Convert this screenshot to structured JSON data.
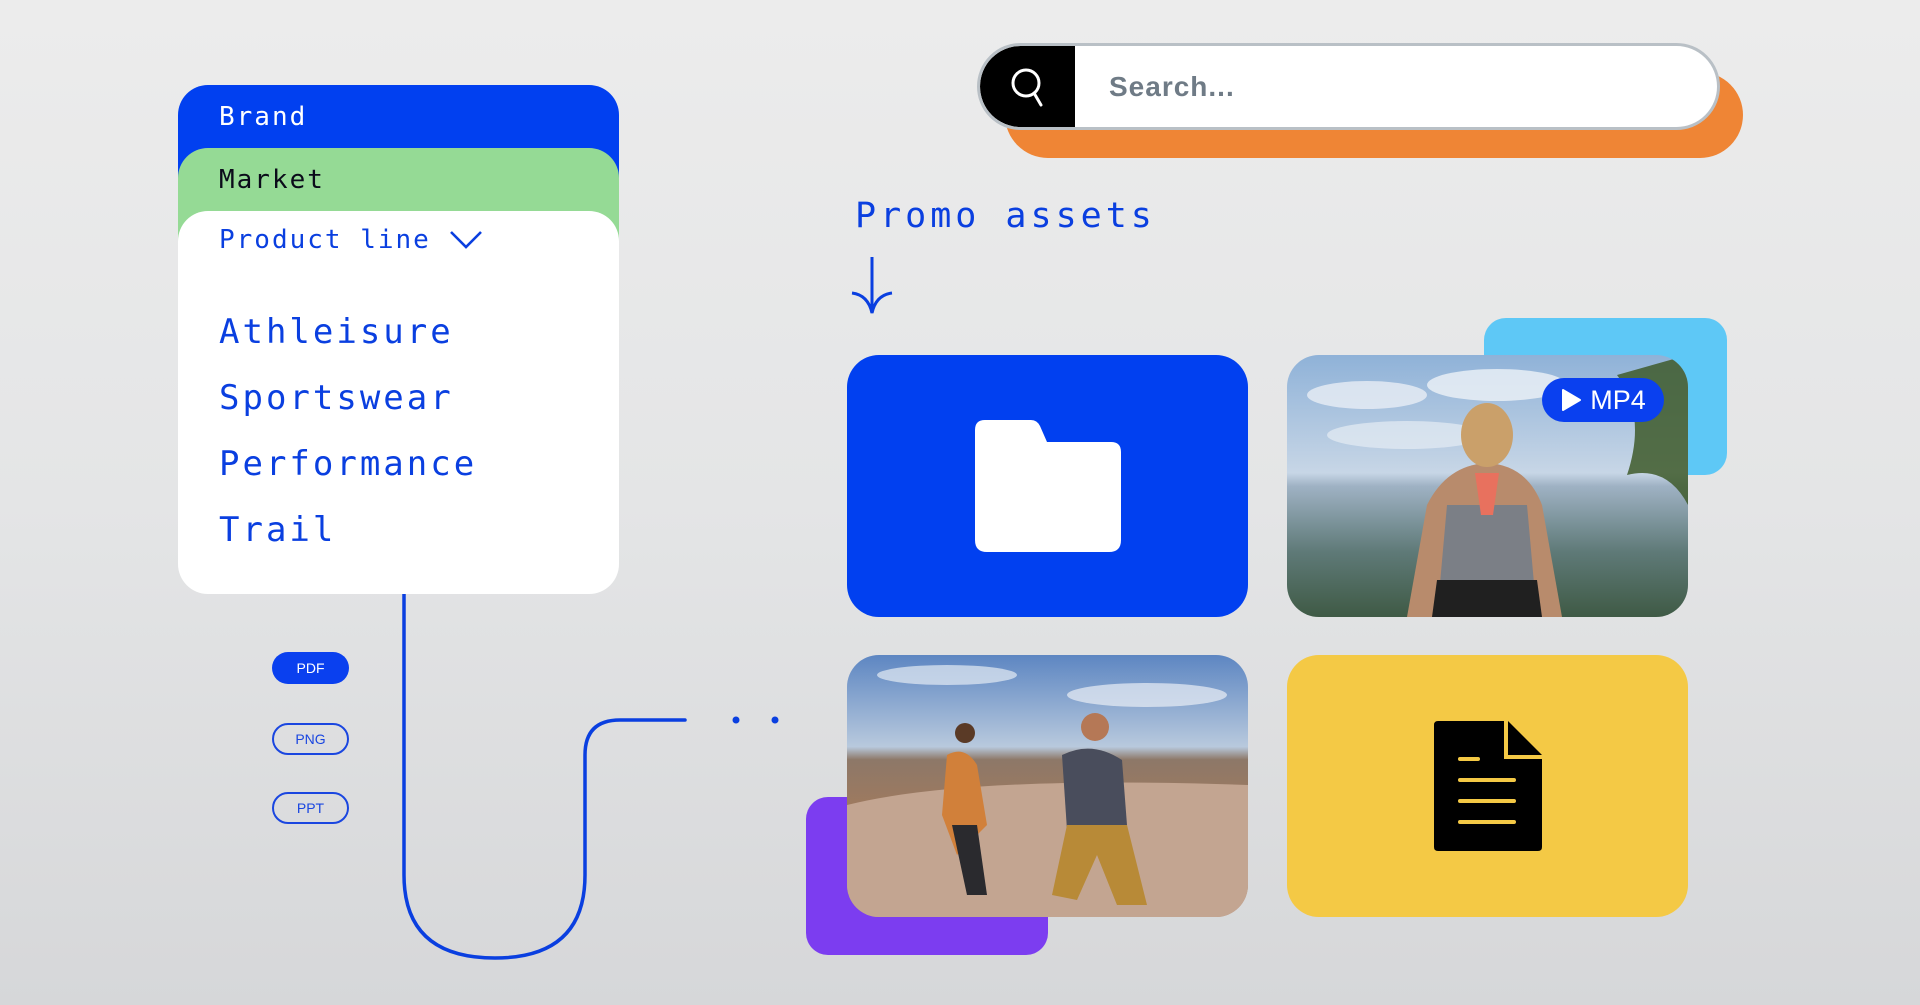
{
  "filters": {
    "brand_label": "Brand",
    "market_label": "Market",
    "product_line_label": "Product line",
    "product_line_options": [
      "Athleisure",
      "Sportswear",
      "Performance",
      "Trail"
    ]
  },
  "file_types": [
    "PDF",
    "PNG",
    "PPT"
  ],
  "search": {
    "placeholder": "Search..."
  },
  "promo": {
    "title": "Promo assets"
  },
  "assets": {
    "folder_icon": "folder-icon",
    "video_badge": "MP4",
    "video_icon": "play-icon",
    "document_icon": "document-icon",
    "photo1_description": "Woman in tank top with hands on hips overlooking valley",
    "photo2_description": "Two men running on canyon rock trail"
  },
  "colors": {
    "brand_blue": "#0140f0",
    "market_green": "#95da95",
    "search_orange": "#ef8535",
    "cyan": "#5ec8f6",
    "purple": "#7c3df0",
    "yellow": "#f4c945"
  }
}
